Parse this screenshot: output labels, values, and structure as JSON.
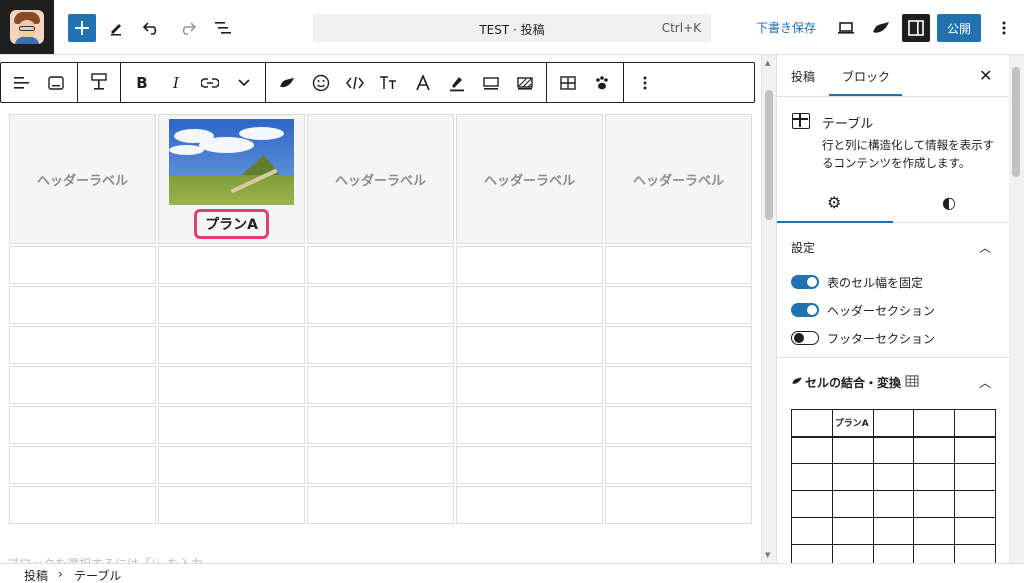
{
  "topbar": {
    "add_label": "+",
    "doc_title": "TEST · 投稿",
    "shortcut": "Ctrl+K",
    "save_draft": "下書き保存",
    "publish": "公開"
  },
  "table": {
    "headers": [
      "ヘッダーラベル",
      "プランA",
      "ヘッダーラベル",
      "ヘッダーラベル",
      "ヘッダーラベル"
    ],
    "body_rows": 7
  },
  "editor": {
    "hint": "ブロックを選択するには「/」を入力"
  },
  "sidebar": {
    "tab_post": "投稿",
    "tab_block": "ブロック",
    "block_name": "テーブル",
    "block_desc": "行と列に構造化して情報を表示するコンテンツを作成します。",
    "settings_title": "設定",
    "toggles": [
      {
        "label": "表のセル幅を固定",
        "on": true
      },
      {
        "label": "ヘッダーセクション",
        "on": true
      },
      {
        "label": "フッターセクション",
        "on": false
      }
    ],
    "merge_title": "セルの結合・変換",
    "mini_header": [
      "",
      "プランA",
      "",
      "",
      ""
    ]
  },
  "breadcrumb": {
    "root": "投稿",
    "sep": "›",
    "leaf": "テーブル"
  },
  "colors": {
    "accent": "#2271b1",
    "highlight": "#e0407a"
  }
}
